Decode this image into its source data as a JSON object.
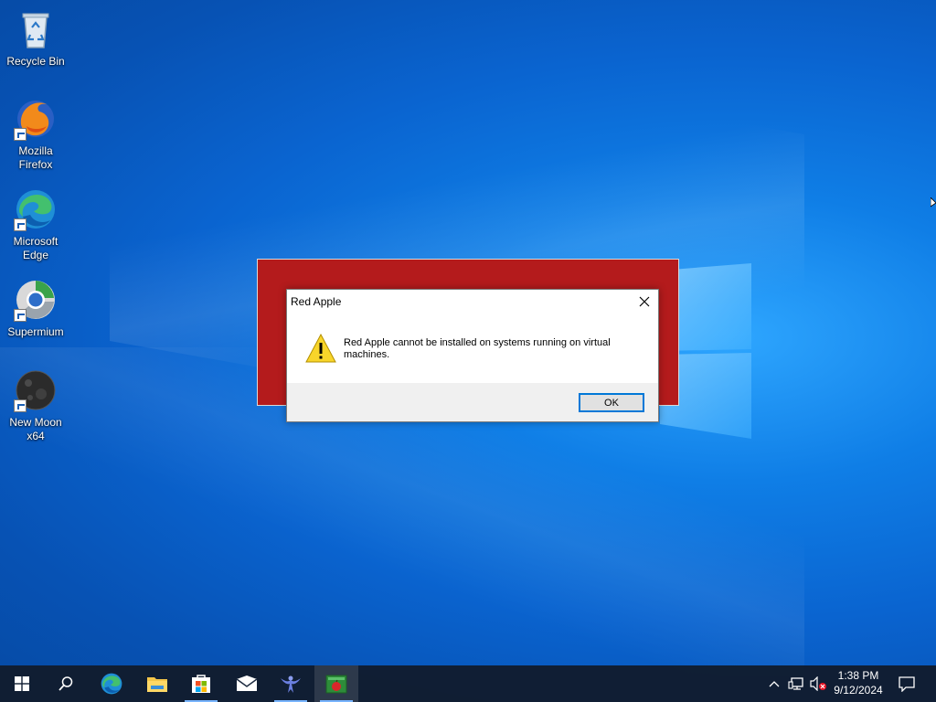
{
  "desktop": {
    "icons": [
      {
        "label": "Recycle Bin",
        "icon": "recycle-bin-icon"
      },
      {
        "label": "Mozilla Firefox",
        "icon": "firefox-icon"
      },
      {
        "label": "Microsoft Edge",
        "icon": "edge-icon"
      },
      {
        "label": "Supermium",
        "icon": "supermium-icon"
      },
      {
        "label": "New Moon x64",
        "icon": "new-moon-icon"
      }
    ]
  },
  "dialog": {
    "title": "Red Apple",
    "message": "Red Apple cannot be installed on systems running on virtual machines.",
    "ok_label": "OK",
    "icon": "warning-icon"
  },
  "app_window": {
    "color": "#b41b1c"
  },
  "taskbar": {
    "items": [
      {
        "name": "start",
        "icon": "windows-start-icon"
      },
      {
        "name": "search",
        "icon": "search-icon"
      },
      {
        "name": "edge",
        "icon": "edge-icon"
      },
      {
        "name": "file-explorer",
        "icon": "folder-icon"
      },
      {
        "name": "store",
        "icon": "store-icon"
      },
      {
        "name": "mail",
        "icon": "mail-icon"
      },
      {
        "name": "bird-app",
        "icon": "bird-icon"
      },
      {
        "name": "red-apple",
        "icon": "red-apple-icon",
        "active": true
      }
    ],
    "clock": {
      "time": "1:38 PM",
      "date": "9/12/2024"
    }
  }
}
